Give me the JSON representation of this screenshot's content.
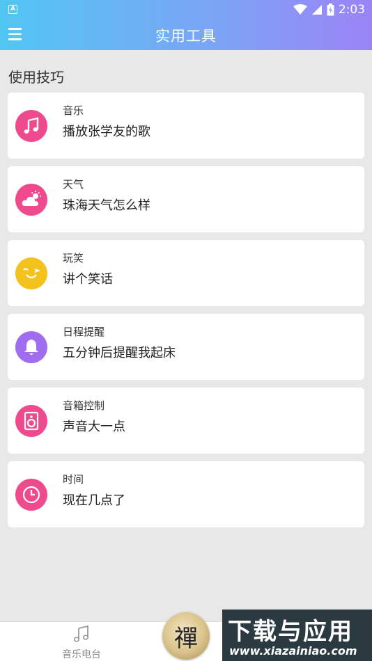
{
  "status_bar": {
    "app_icon": "A",
    "time": "2:03"
  },
  "app_bar": {
    "title": "实用工具",
    "menu_icon": "hamburger-icon"
  },
  "section": {
    "title": "使用技巧"
  },
  "cards": [
    {
      "category": "音乐",
      "example": "播放张学友的歌",
      "icon": "music-note-icon",
      "color": "#f04a8f"
    },
    {
      "category": "天气",
      "example": "珠海天气怎么样",
      "icon": "weather-icon",
      "color": "#f04a8f"
    },
    {
      "category": "玩笑",
      "example": "讲个笑话",
      "icon": "smile-icon",
      "color": "#f3c21d"
    },
    {
      "category": "日程提醒",
      "example": "五分钟后提醒我起床",
      "icon": "bell-icon",
      "color": "#a06cf0"
    },
    {
      "category": "音箱控制",
      "example": "声音大一点",
      "icon": "speaker-icon",
      "color": "#f04a8f"
    },
    {
      "category": "时间",
      "example": "现在几点了",
      "icon": "clock-icon",
      "color": "#f04a8f"
    }
  ],
  "bottom_nav": {
    "items": [
      {
        "label": "音乐电台",
        "icon": "music-note-icon"
      }
    ],
    "center_button": {
      "glyph": "禪"
    }
  },
  "watermark": {
    "title": "下载与应用",
    "url": "www.xiazainiao.com"
  }
}
